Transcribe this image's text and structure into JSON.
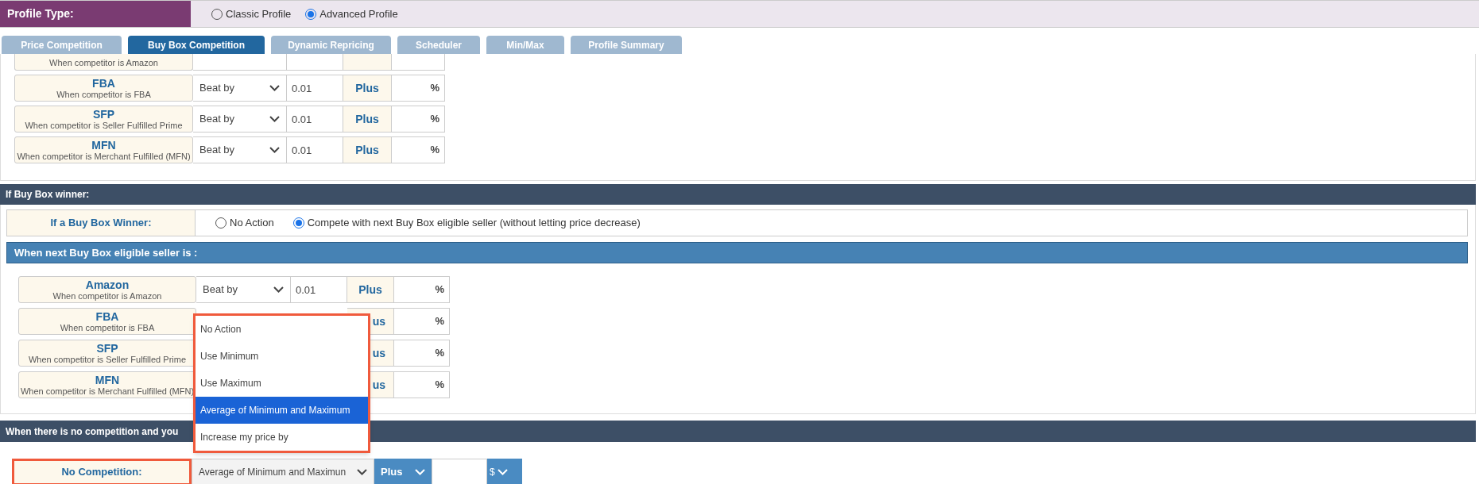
{
  "profile_type": {
    "label": "Profile Type:",
    "options": [
      {
        "label": "Classic Profile",
        "selected": false
      },
      {
        "label": "Advanced Profile",
        "selected": true
      }
    ]
  },
  "tabs": [
    {
      "label": "Price Competition",
      "selected": false
    },
    {
      "label": "Buy Box Competition",
      "selected": true
    },
    {
      "label": "Dynamic Repricing",
      "selected": false
    },
    {
      "label": "Scheduler",
      "selected": false
    },
    {
      "label": "Min/Max",
      "selected": false
    },
    {
      "label": "Profile Summary",
      "selected": false
    }
  ],
  "competition_table": {
    "rows": [
      {
        "kind": "cut",
        "subtitle": "When competitor is Amazon"
      },
      {
        "kind": "full",
        "title": "FBA",
        "subtitle": "When competitor is FBA",
        "rule": "Beat by",
        "amount": "0.01",
        "plus": "Plus",
        "unit": "%"
      },
      {
        "kind": "full",
        "title": "SFP",
        "subtitle": "When competitor is Seller Fulfilled Prime",
        "rule": "Beat by",
        "amount": "0.01",
        "plus": "Plus",
        "unit": "%"
      },
      {
        "kind": "full",
        "title": "MFN",
        "subtitle": "When competitor is Merchant Fulfilled (MFN)",
        "rule": "Beat by",
        "amount": "0.01",
        "plus": "Plus",
        "unit": "%"
      }
    ]
  },
  "winner_section": {
    "header": "If Buy Box winner:",
    "label": "If a Buy Box Winner:",
    "options": [
      {
        "label": "No Action",
        "selected": false
      },
      {
        "label": "Compete with next Buy Box eligible seller (without letting price decrease)",
        "selected": true
      }
    ]
  },
  "next_seller": {
    "header": "When next Buy Box eligible seller is :",
    "rows": [
      {
        "kind": "full",
        "title": "Amazon",
        "subtitle": "When competitor is Amazon",
        "rule": "Beat by",
        "amount": "0.01",
        "plus": "Plus",
        "unit": "%"
      },
      {
        "kind": "covered",
        "title": "FBA",
        "subtitle": "When competitor is FBA",
        "plus": "us",
        "unit": "%"
      },
      {
        "kind": "covered",
        "title": "SFP",
        "subtitle": "When competitor is Seller Fulfilled Prime",
        "plus": "us",
        "unit": "%"
      },
      {
        "kind": "covered",
        "title": "MFN",
        "subtitle": "When competitor is Merchant Fulfilled (MFN)",
        "plus": "us",
        "unit": "%"
      }
    ]
  },
  "no_competition": {
    "header": "When there is no competition and you",
    "label": "No Competition:",
    "highlighted": true,
    "rule": "Average of Minimum and Maximun",
    "mode": "Plus",
    "unit": "$"
  },
  "dropdown": {
    "highlighted": true,
    "options": [
      {
        "label": "No Action",
        "selected": false
      },
      {
        "label": "Use Minimum",
        "selected": false
      },
      {
        "label": "Use Maximum",
        "selected": false
      },
      {
        "label": "Average of Minimum and Maximum",
        "selected": true
      },
      {
        "label": "Increase my price by",
        "selected": false
      }
    ]
  }
}
